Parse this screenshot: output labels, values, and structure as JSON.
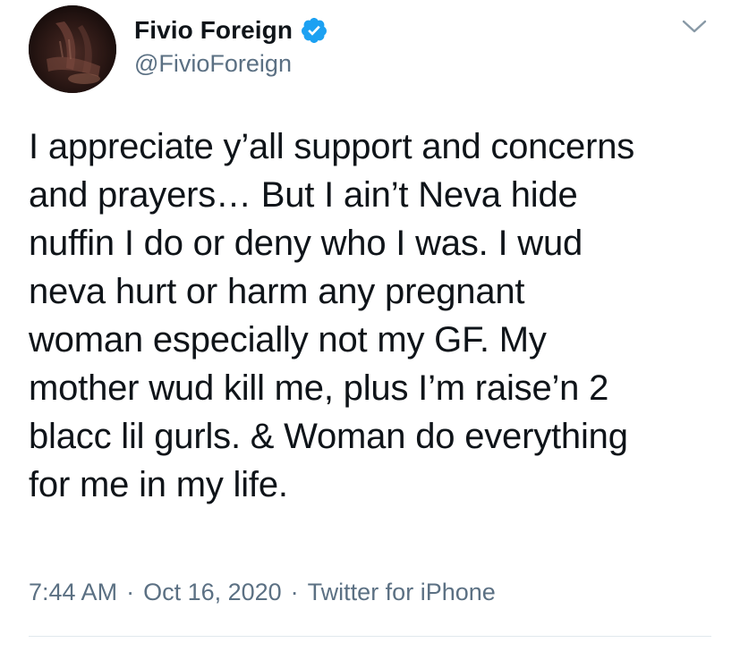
{
  "tweet": {
    "author": {
      "display_name": "Fivio Foreign",
      "handle": "@FivioForeign",
      "verified": true,
      "verified_icon": "verified-badge-icon",
      "avatar_icon": "avatar-photo"
    },
    "text": "I appreciate y’all support and concerns\nand prayers… But I ain’t Neva hide\nnuffin I do or deny who I was. I wud\nneva hurt or harm any pregnant\nwoman especially not my GF. My\nmother wud kill me, plus I’m raise’n 2\nblacc lil gurls. & Woman do everything\nfor me in my life.",
    "time": "7:44 AM",
    "date": "Oct 16, 2020",
    "source": "Twitter for iPhone",
    "separator": "·",
    "menu_icon": "chevron-down-icon"
  },
  "colors": {
    "text_primary": "#0f1419",
    "text_secondary": "#5b7083",
    "verified_blue": "#1da1f2",
    "divider": "#e1e8ed"
  }
}
